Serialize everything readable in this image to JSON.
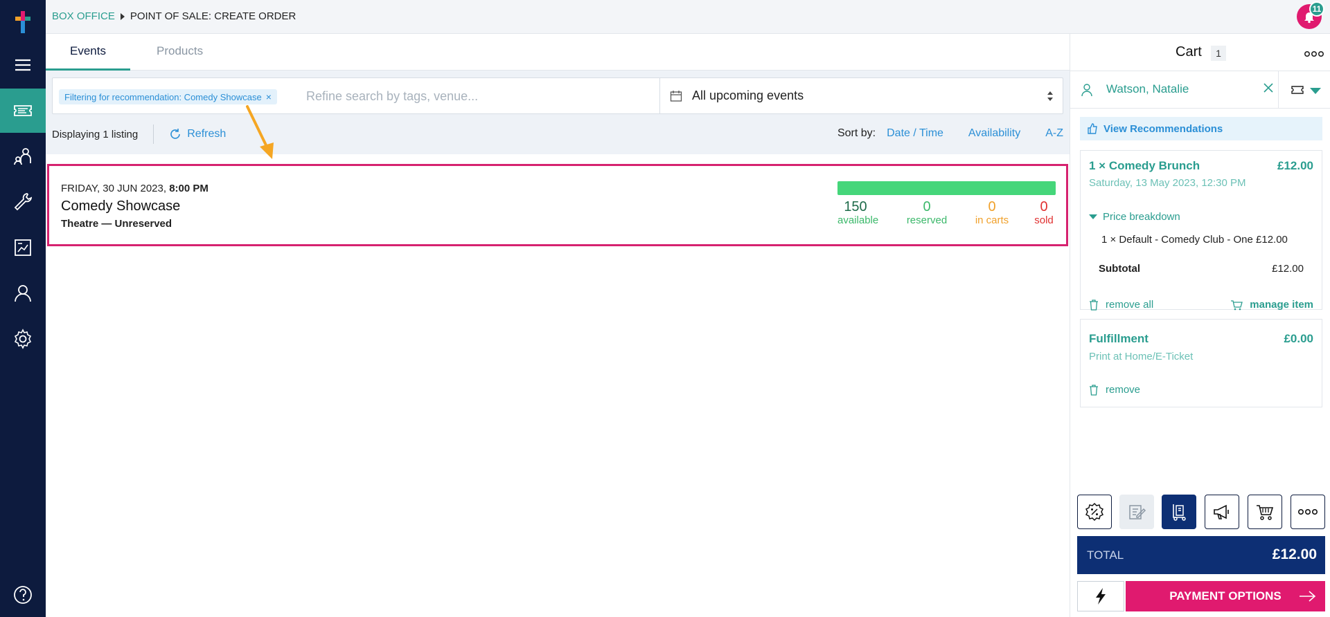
{
  "breadcrumb": {
    "root": "BOX OFFICE",
    "current": "POINT OF SALE: CREATE ORDER"
  },
  "notifications": {
    "count": "11"
  },
  "tabs": [
    {
      "label": "Events"
    },
    {
      "label": "Products"
    }
  ],
  "filter": {
    "chip": "Filtering for recommendation: Comedy Showcase",
    "search_placeholder": "Refine search by tags, venue...",
    "date_range": "All upcoming events"
  },
  "listbar": {
    "count": "Displaying 1 listing",
    "refresh": "Refresh",
    "sort_label": "Sort by:",
    "sort_options": [
      "Date / Time",
      "Availability",
      "A-Z"
    ]
  },
  "listing": {
    "date": "FRIDAY, 30 JUN 2023,",
    "time": "8:00 PM",
    "title": "Comedy Showcase",
    "venue": "Theatre — Unreserved",
    "available": "150",
    "reserved": "0",
    "in_carts": "0",
    "sold": "0",
    "available_label": "available",
    "reserved_label": "reserved",
    "in_carts_label": "in carts",
    "sold_label": "sold",
    "available_fraction": 1.0
  },
  "cart": {
    "title": "Cart",
    "count": "1",
    "customer": "Watson, Natalie",
    "recommendations": "View Recommendations",
    "item": {
      "title": "1 × Comedy Brunch",
      "price": "£12.00",
      "date": "Saturday, 13 May 2023, 12:30 PM",
      "breakdown_label": "Price breakdown",
      "breakdown_line": "1 × Default - Comedy Club - One £12.00",
      "subtotal_label": "Subtotal",
      "subtotal": "£12.00",
      "remove_all": "remove all",
      "manage": "manage item"
    },
    "fulfillment": {
      "title": "Fulfillment",
      "price": "£0.00",
      "method": "Print at Home/E-Ticket",
      "remove": "remove"
    },
    "total_label": "TOTAL",
    "total": "£12.00",
    "pay": "PAYMENT OPTIONS"
  },
  "colors": {
    "accent": "#2a9d8f",
    "link": "#2b8fd6",
    "nav": "#0d1b3e",
    "highlight": "#d6226f",
    "pay": "#e01a6f",
    "available": "#45d67a",
    "reserved": "#3bb86a",
    "in_carts": "#f0a02a",
    "sold": "#e03030"
  },
  "icons": [
    "logo-icon",
    "menu-icon",
    "ticket-icon",
    "people-icon",
    "wrench-icon",
    "report-icon",
    "person-icon",
    "gear-icon",
    "help-icon",
    "bell-icon",
    "calendar-icon",
    "refresh-icon",
    "close-icon",
    "thumbs-up-icon",
    "trash-icon",
    "cart-icon",
    "discount-icon",
    "notes-icon",
    "delivery-icon",
    "megaphone-icon",
    "shopping-cart-icon",
    "more-icon",
    "bolt-icon",
    "arrow-right-icon"
  ]
}
